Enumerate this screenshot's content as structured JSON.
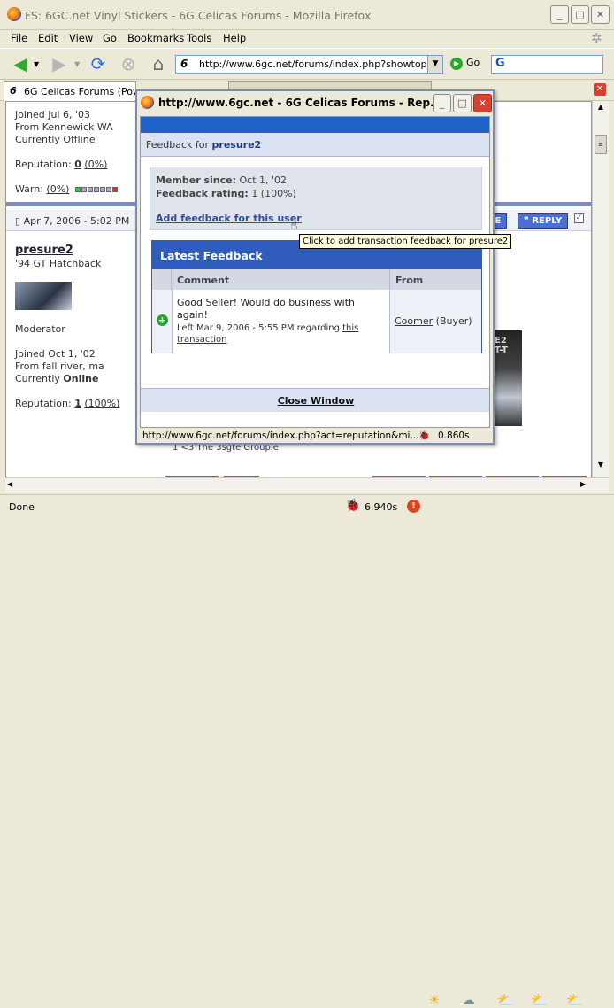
{
  "window": {
    "title": "FS: 6GC.net Vinyl Stickers - 6G Celicas Forums - Mozilla Firefox"
  },
  "menu": {
    "file": "File",
    "edit": "Edit",
    "view": "View",
    "go": "Go",
    "bookmarks": "Bookmarks",
    "tools": "Tools",
    "help": "Help"
  },
  "nav": {
    "url": "http://www.6gc.net/forums/index.php?showtopic",
    "go_label": "Go",
    "search_logo": "G"
  },
  "tabs": {
    "tab1": "6G Celicas Forums (Powe"
  },
  "posts": {
    "p1_joined": "Joined Jul 6, '03",
    "p1_from": "From Kennewick WA",
    "p1_status_prefix": "Currently ",
    "p1_status": "Offline",
    "p1_rep_label": "Reputation: ",
    "p1_rep_val": "0",
    "p1_rep_pct": "(0%)",
    "p1_warn_label": "Warn: ",
    "p1_warn_pct": "(0%)",
    "p2_date": "Apr 7, 2006 - 5:02 PM",
    "p2_user": "presure2",
    "p2_car": "'94 GT Hatchback",
    "p2_role": "Moderator",
    "p2_joined": "Joined Oct 1, '02",
    "p2_from": "From fall river, ma",
    "p2_status_prefix": "Currently ",
    "p2_status": "Online",
    "p2_rep_label": "Reputation: ",
    "p2_rep_val": "1",
    "p2_rep_pct": "(100%)",
    "quote_btn": "OTE",
    "reply_btn": "REPLY",
    "footer_text": "1 <3 The 3sgte Groupie",
    "image_text1": "E2",
    "image_text2": "T-T"
  },
  "popup": {
    "title": "http://www.6gc.net - 6G Celicas Forums - Rep...",
    "feedback_for": "Feedback for ",
    "user": "presure2",
    "member_since_label": "Member since:",
    "member_since": "Oct 1, '02",
    "rating_label": "Feedback rating:",
    "rating": "1 (100%)",
    "add_link": "Add feedback for this user",
    "latest_title": "Latest Feedback",
    "col_comment": "Comment",
    "col_from": "From",
    "row_comment": "Good Seller! Would do business with again!",
    "row_left": "Left Mar 9, 2006 - 5:55 PM regarding ",
    "row_link1": "this",
    "row_link2": "transaction",
    "row_from_user": "Coomer",
    "row_from_role": " (Buyer)",
    "close": "Close Window",
    "status_url": "http://www.6gc.net/forums/index.php?act=reputation&mi...",
    "status_time": "0.860s"
  },
  "tooltip": "Click to add transaction feedback for presure2",
  "status": {
    "text": "Done",
    "time": "6.940s"
  },
  "colors": {
    "accent": "#2f5cbe",
    "stripe": "#1e64c8",
    "header_bg": "#dbe3f3"
  }
}
